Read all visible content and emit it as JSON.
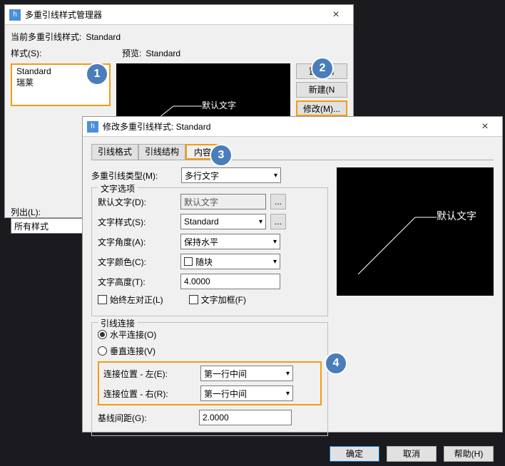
{
  "win1": {
    "title": "多重引线样式管理器",
    "current_label": "当前多重引线样式:",
    "current_value": "Standard",
    "styles_label": "样式(S):",
    "preview_label": "预览:",
    "preview_value": "Standard",
    "list_items": [
      "Standard",
      "瑞莱"
    ],
    "preview_text": "默认文字",
    "btn_set_current": "置为当",
    "btn_new": "新建(N",
    "btn_modify": "修改(M)...",
    "list_out_label": "列出(L):",
    "list_out_value": "所有样式"
  },
  "win2": {
    "title": "修改多重引线样式: Standard",
    "tabs": {
      "t1": "引线格式",
      "t2": "引线结构",
      "t3": "内容"
    },
    "mtype_label": "多重引线类型(M):",
    "mtype_value": "多行文字",
    "group_text": "文字选项",
    "default_text_label": "默认文字(D):",
    "default_text_value": "默认文字",
    "text_style_label": "文字样式(S):",
    "text_style_value": "Standard",
    "text_angle_label": "文字角度(A):",
    "text_angle_value": "保持水平",
    "text_color_label": "文字颜色(C):",
    "text_color_value": "随块",
    "text_height_label": "文字高度(T):",
    "text_height_value": "4.0000",
    "chk_left_align": "始终左对正(L)",
    "chk_frame": "文字加框(F)",
    "group_attach": "引线连接",
    "radio_horiz": "水平连接(O)",
    "radio_vert": "垂直连接(V)",
    "attach_left_label": "连接位置 - 左(E):",
    "attach_left_value": "第一行中间",
    "attach_right_label": "连接位置 - 右(R):",
    "attach_right_value": "第一行中间",
    "baseline_gap_label": "基线间距(G):",
    "baseline_gap_value": "2.0000",
    "preview_text": "默认文字",
    "btn_ok": "确定",
    "btn_cancel": "取消",
    "btn_help": "帮助(H)"
  },
  "annotations": {
    "n1": "1",
    "n2": "2",
    "n3": "3",
    "n4": "4"
  }
}
